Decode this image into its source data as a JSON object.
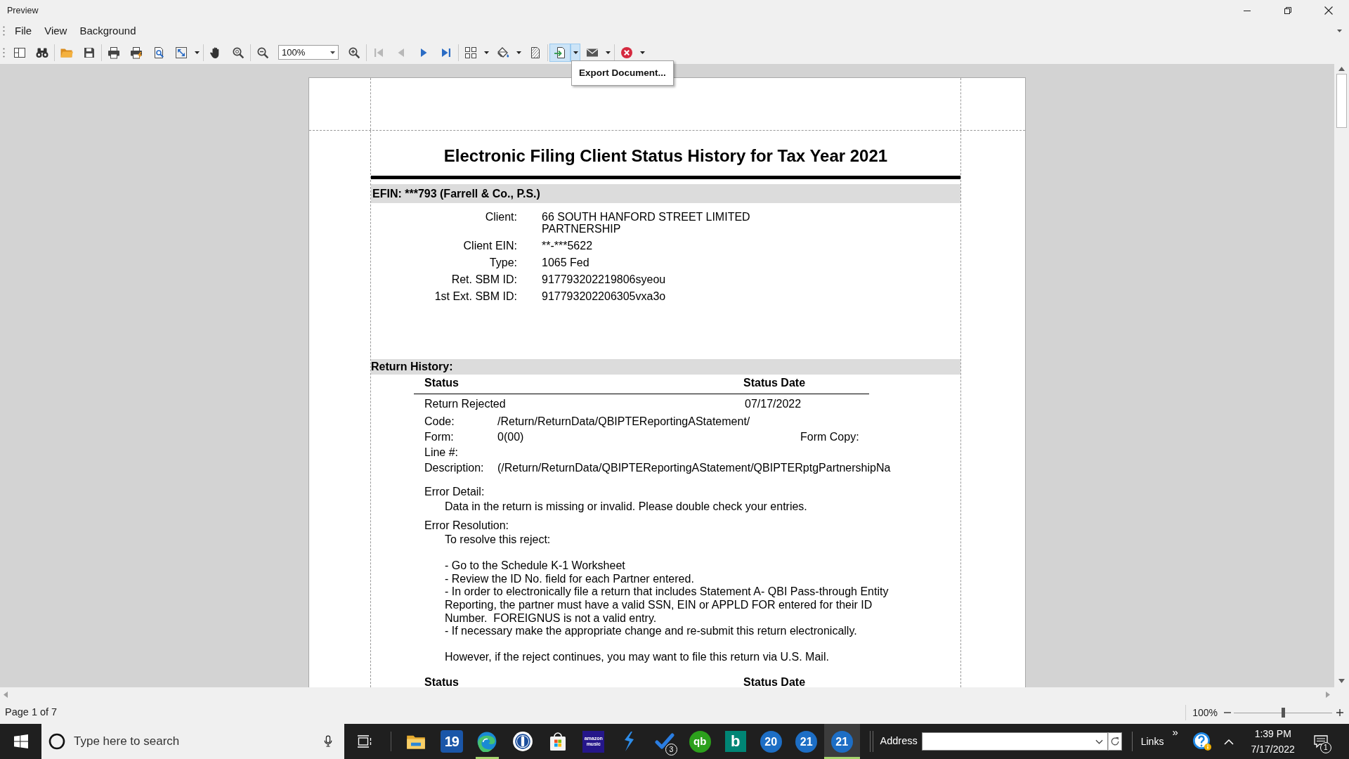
{
  "window": {
    "title": "Preview"
  },
  "menu": [
    {
      "label": "File"
    },
    {
      "label": "View"
    },
    {
      "label": "Background"
    }
  ],
  "toolbar": {
    "groups": [
      [
        {
          "kind": "button",
          "disabled": false,
          "pressed": false
        },
        {
          "kind": "button",
          "disabled": false,
          "pressed": false
        }
      ],
      [
        {
          "kind": "button",
          "disabled": false,
          "pressed": false
        },
        {
          "kind": "button",
          "disabled": false,
          "pressed": false
        }
      ],
      [
        {
          "kind": "button",
          "disabled": false,
          "pressed": false
        },
        {
          "kind": "button",
          "disabled": false,
          "pressed": false
        },
        {
          "kind": "button",
          "disabled": false,
          "pressed": false
        },
        {
          "kind": "split",
          "disabled": false,
          "pressed": false
        }
      ],
      [
        {
          "kind": "button",
          "disabled": false,
          "pressed": false
        },
        {
          "kind": "button",
          "disabled": false,
          "pressed": false
        }
      ],
      [
        {
          "kind": "button",
          "disabled": false,
          "pressed": false
        },
        {
          "kind": "combo",
          "value": "100%",
          "disabled": false,
          "pressed": false
        },
        {
          "kind": "button",
          "disabled": false,
          "pressed": false
        }
      ],
      [
        {
          "kind": "button",
          "disabled": true,
          "pressed": false
        },
        {
          "kind": "button",
          "disabled": true,
          "pressed": false
        },
        {
          "kind": "button",
          "disabled": false,
          "pressed": false
        },
        {
          "kind": "button",
          "disabled": false,
          "pressed": false
        }
      ],
      [
        {
          "kind": "split",
          "disabled": false,
          "pressed": false
        },
        {
          "kind": "split",
          "disabled": false,
          "pressed": false
        },
        {
          "kind": "button",
          "disabled": false,
          "pressed": false
        }
      ],
      [
        {
          "kind": "split",
          "disabled": false,
          "pressed": true,
          "tooltip": "Export Document..."
        },
        {
          "kind": "split",
          "disabled": false,
          "pressed": false
        }
      ],
      [
        {
          "kind": "split",
          "disabled": false,
          "pressed": false
        }
      ]
    ]
  },
  "document": {
    "title": "Electronic Filing Client Status History for Tax Year 2021",
    "efin": "EFIN: ***793 (Farrell & Co., P.S.)",
    "client_fields": [
      {
        "label": "Client:",
        "value": "66 SOUTH HANFORD STREET LIMITED PARTNERSHIP"
      },
      {
        "label": "Client EIN:",
        "value": "**-***5622"
      },
      {
        "label": "Type:",
        "value": "1065 Fed"
      },
      {
        "label": "Ret. SBM ID:",
        "value": "917793202219806syeou"
      },
      {
        "label": "1st Ext. SBM ID:",
        "value": "917793202206305vxa3o"
      }
    ],
    "return_history": {
      "heading": "Return History:",
      "entries": [
        {
          "columns": [
            "Status",
            "Status Date"
          ],
          "status": "Return Rejected",
          "status_date": "07/17/2022",
          "details": [
            {
              "label": "Code:",
              "value": "/Return/ReturnData/QBIPTEReportingAStatement/"
            },
            {
              "label": "Form:",
              "value": "0(00)",
              "form_copy_label": "Form Copy:"
            },
            {
              "label": "Line #:"
            },
            {
              "label": "Description:",
              "value": "(/Return/ReturnData/QBIPTEReportingAStatement/QBIPTERptgPartnershipNa"
            }
          ],
          "error_detail_label": "Error Detail:",
          "error_detail": "Data in the return is missing or invalid. Please double check your entries.",
          "error_resolution_label": "Error Resolution:",
          "error_resolution": [
            [
              "To resolve this reject:"
            ],
            [
              "- Go to the Schedule K-1 Worksheet",
              "- Review the ID No. field for each Partner entered.",
              "- In order to electronically file a return that includes Statement A- QBI Pass-through Entity Reporting, the partner must have a valid SSN, EIN or APPLD FOR entered for their ID Number.  FOREIGNUS is not a valid entry.",
              "- If necessary make the appropriate change and re-submit this return electronically."
            ],
            [
              "However, if the reject continues, you may want to file this return via U.S. Mail."
            ]
          ]
        },
        {
          "columns": [
            "Status",
            "Status Date"
          ]
        }
      ]
    }
  },
  "status_bar": {
    "page": "Page 1 of 7",
    "zoom": "100%",
    "zoom_slider": {
      "level": 0.5
    }
  },
  "taskbar": {
    "search": {
      "placeholder": "Type here to search"
    },
    "apps": [
      {
        "kind": "explorer",
        "running": false,
        "selected": false
      },
      {
        "kind": "tile",
        "label": "19",
        "running": false,
        "selected": false
      },
      {
        "kind": "browser",
        "running": true,
        "selected": false
      },
      {
        "kind": "vault",
        "running": false,
        "selected": false
      },
      {
        "kind": "store",
        "running": false,
        "selected": false
      },
      {
        "kind": "music",
        "label": "amazon music",
        "running": false,
        "selected": false
      },
      {
        "kind": "bolt",
        "running": false,
        "selected": false
      },
      {
        "kind": "todo",
        "badge": "3",
        "running": false,
        "selected": false
      },
      {
        "kind": "ledger",
        "label": "qb",
        "running": false,
        "selected": false
      },
      {
        "kind": "square",
        "label": "b",
        "running": false,
        "selected": false
      },
      {
        "kind": "disc",
        "label": "20",
        "running": false,
        "selected": false
      },
      {
        "kind": "disc",
        "label": "21",
        "running": false,
        "selected": false
      },
      {
        "kind": "disc",
        "label": "21",
        "running": true,
        "selected": true
      }
    ],
    "address_label": "Address",
    "links_label": "Links",
    "links_overflow": "»",
    "time": "1:39 PM",
    "date": "7/17/2022",
    "notifications": "1"
  }
}
